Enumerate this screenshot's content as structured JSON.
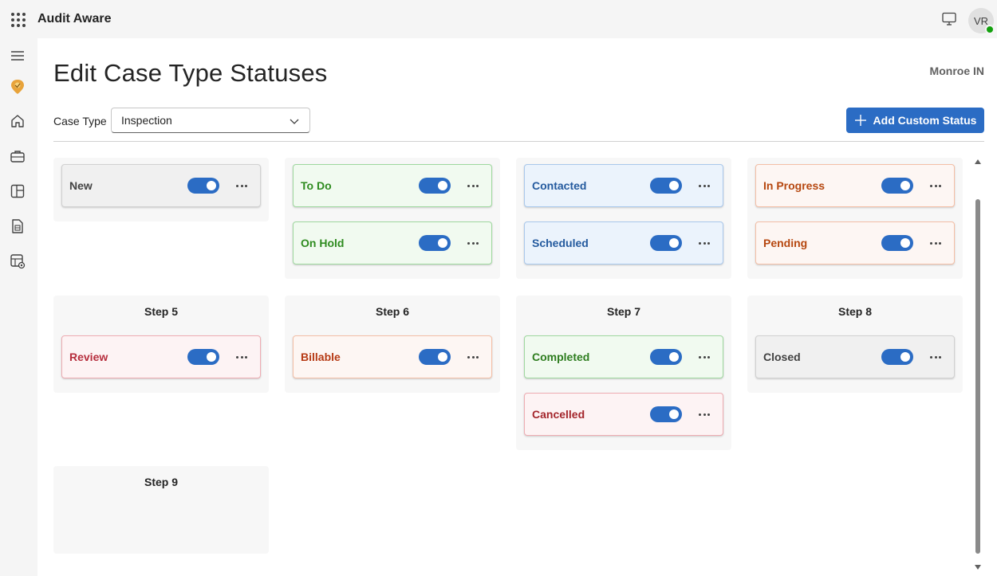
{
  "app": {
    "title": "Audit Aware"
  },
  "user": {
    "initials": "VR"
  },
  "page": {
    "title": "Edit Case Type Statuses",
    "org": "Monroe IN"
  },
  "filter": {
    "label": "Case Type",
    "value": "Inspection"
  },
  "actions": {
    "add_status": "Add Custom Status"
  },
  "rail": {
    "items": [
      "menu-icon",
      "app-logo-icon",
      "home-icon",
      "briefcase-icon",
      "board-icon",
      "document-table-icon",
      "settings-table-icon"
    ]
  },
  "columns": [
    {
      "title": "",
      "cards": [
        {
          "label": "New",
          "color": "#424242",
          "bg": "#f0f0f0",
          "border": "#d1d1d1",
          "enabled": true
        }
      ]
    },
    {
      "title": "",
      "cards": [
        {
          "label": "To Do",
          "color": "#2e8b1f",
          "bg": "#f1faf0",
          "border": "#9fd89f",
          "enabled": true
        },
        {
          "label": "On Hold",
          "color": "#2e8b1f",
          "bg": "#f1faf0",
          "border": "#9fd89f",
          "enabled": true
        }
      ]
    },
    {
      "title": "",
      "cards": [
        {
          "label": "Contacted",
          "color": "#245a9e",
          "bg": "#ebf3fc",
          "border": "#a9c8ec",
          "enabled": true
        },
        {
          "label": "Scheduled",
          "color": "#245a9e",
          "bg": "#ebf3fc",
          "border": "#a9c8ec",
          "enabled": true
        }
      ]
    },
    {
      "title": "",
      "cards": [
        {
          "label": "In Progress",
          "color": "#b6470f",
          "bg": "#fdf6f3",
          "border": "#f4bfa6",
          "enabled": true
        },
        {
          "label": "Pending",
          "color": "#b6470f",
          "bg": "#fdf6f3",
          "border": "#f4bfa6",
          "enabled": true
        }
      ]
    },
    {
      "title": "Step 5",
      "cards": [
        {
          "label": "Review",
          "color": "#b62e3d",
          "bg": "#fdf3f4",
          "border": "#eeacb2",
          "enabled": true
        }
      ]
    },
    {
      "title": "Step 6",
      "cards": [
        {
          "label": "Billable",
          "color": "#b63a14",
          "bg": "#fdf6f3",
          "border": "#f4bfa6",
          "enabled": true
        }
      ]
    },
    {
      "title": "Step 7",
      "cards": [
        {
          "label": "Completed",
          "color": "#2e7d1f",
          "bg": "#f1faf0",
          "border": "#9fd89f",
          "enabled": true
        },
        {
          "label": "Cancelled",
          "color": "#a4262c",
          "bg": "#fdf3f4",
          "border": "#eeacb2",
          "enabled": true
        }
      ]
    },
    {
      "title": "Step 8",
      "cards": [
        {
          "label": "Closed",
          "color": "#424242",
          "bg": "#f0f0f0",
          "border": "#d1d1d1",
          "enabled": true
        }
      ]
    },
    {
      "title": "Step 9",
      "cards": []
    }
  ]
}
